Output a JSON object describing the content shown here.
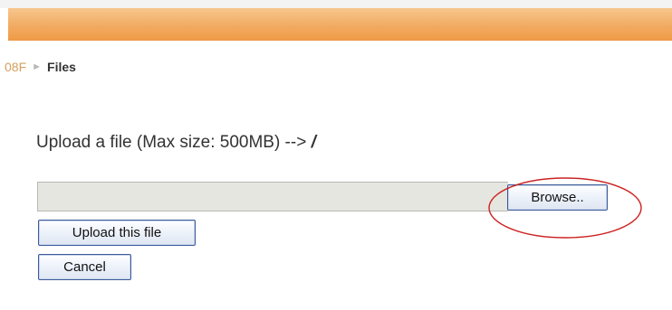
{
  "breadcrumb": {
    "parent": "08F",
    "separator": "►",
    "current": "Files"
  },
  "upload": {
    "heading": "Upload a file (Max size: 500MB) -->",
    "path": "/",
    "browse_label": "Browse..",
    "upload_label": "Upload this file",
    "cancel_label": "Cancel"
  },
  "colors": {
    "header_bar": "#f2ab62",
    "highlight_ellipse": "#cc2222",
    "button_border": "#3c5a9a"
  }
}
